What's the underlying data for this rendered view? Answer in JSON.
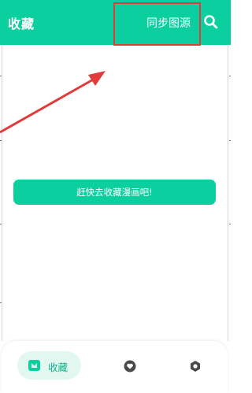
{
  "header": {
    "title": "收藏",
    "sync_label": "同步图源",
    "search_icon": "search-icon"
  },
  "main": {
    "empty_cta_label": "赶快去收藏漫画吧!"
  },
  "bottom_nav": {
    "items": [
      {
        "label": "收藏",
        "icon": "bookmark-icon",
        "selected": true
      },
      {
        "label": "",
        "icon": "heart-icon",
        "selected": false
      },
      {
        "label": "",
        "icon": "settings-icon",
        "selected": false
      }
    ]
  },
  "colors": {
    "accent": "#0ccf9f",
    "nav_selected_bg": "#e3f7f1",
    "nav_selected_text": "#0bb58a",
    "annotation": "#e23b3b"
  }
}
